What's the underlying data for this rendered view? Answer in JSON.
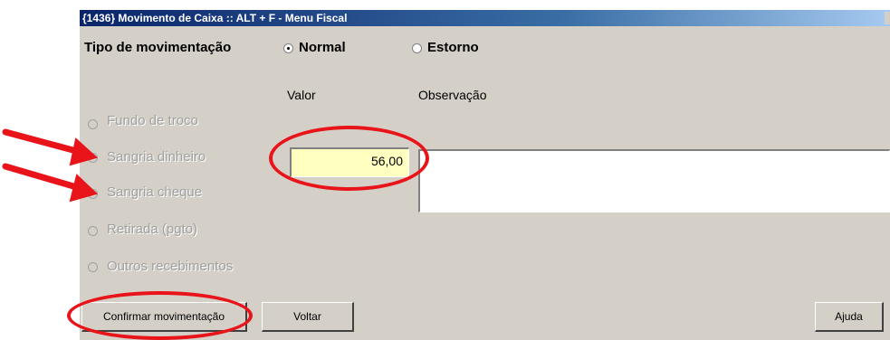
{
  "window": {
    "title": "{1436} Movimento de Caixa :: ALT + F - Menu Fiscal"
  },
  "tipo": {
    "label": "Tipo de movimentação",
    "options": [
      {
        "label": "Normal",
        "selected": true
      },
      {
        "label": "Estorno",
        "selected": false
      }
    ]
  },
  "columns": {
    "valor": "Valor",
    "observacao": "Observação"
  },
  "movimentos": [
    {
      "label": "Fundo de troco",
      "selected": false
    },
    {
      "label": "Sangria dinheiro",
      "selected": true
    },
    {
      "label": "Sangria cheque",
      "selected": false
    },
    {
      "label": "Retirada (pgto)",
      "selected": false
    },
    {
      "label": "Outros recebimentos",
      "selected": false
    }
  ],
  "valor_input": {
    "value": "56,00"
  },
  "observacao_input": {
    "value": ""
  },
  "buttons": {
    "confirmar": "Confirmar movimentação",
    "voltar": "Voltar",
    "ajuda": "Ajuda"
  },
  "annotations": {
    "color": "#e8141a"
  }
}
